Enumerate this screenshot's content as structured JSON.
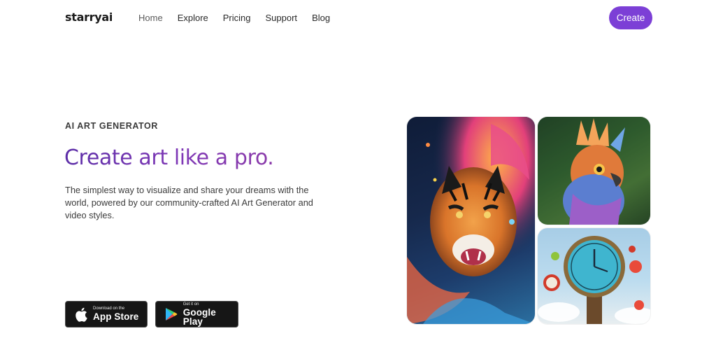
{
  "header": {
    "logo": "starryai",
    "nav": [
      {
        "label": "Home",
        "active": true
      },
      {
        "label": "Explore"
      },
      {
        "label": "Pricing"
      },
      {
        "label": "Support"
      },
      {
        "label": "Blog"
      }
    ],
    "cta_label": "Create",
    "cta_color": "#7c3fd6"
  },
  "hero": {
    "eyebrow": "AI ART GENERATOR",
    "headline": "Create art like a pro.",
    "description": "The simplest way to visualize and share your dreams with the world, powered by our community-crafted AI Art Generator and video styles."
  },
  "stores": {
    "apple": {
      "small": "Download on the",
      "big": "App Store",
      "icon": "apple-icon"
    },
    "google": {
      "small": "Get it on",
      "big": "Google Play",
      "icon": "google-play-icon"
    }
  },
  "gallery": [
    {
      "subject": "tiger",
      "icon": "tiger-artwork"
    },
    {
      "subject": "bird",
      "icon": "bird-artwork"
    },
    {
      "subject": "clock",
      "icon": "clock-artwork"
    }
  ]
}
